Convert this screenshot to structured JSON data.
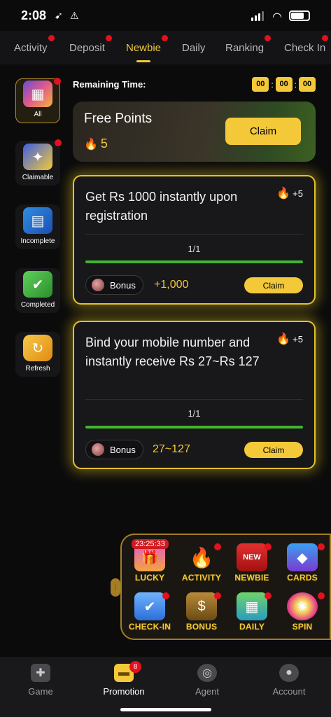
{
  "status_bar": {
    "time": "2:08"
  },
  "tabs": [
    {
      "label": "Activity",
      "dot": true
    },
    {
      "label": "Deposit",
      "dot": true
    },
    {
      "label": "Newbie",
      "dot": true,
      "active": true
    },
    {
      "label": "Daily",
      "dot": false
    },
    {
      "label": "Ranking",
      "dot": true
    },
    {
      "label": "Check In",
      "dot": true
    }
  ],
  "sidebar": {
    "items": [
      {
        "label": "All",
        "icon": "cube-icon",
        "active": true,
        "dot": true
      },
      {
        "label": "Claimable",
        "icon": "gift-stack-icon",
        "dot": true
      },
      {
        "label": "Incomplete",
        "icon": "cards-icon",
        "dot": false
      },
      {
        "label": "Completed",
        "icon": "calendar-check-icon",
        "dot": false
      },
      {
        "label": "Refresh",
        "icon": "refresh-icon",
        "dot": false
      }
    ]
  },
  "remaining": {
    "label": "Remaining Time:",
    "hh": "00",
    "mm": "00",
    "ss": "00"
  },
  "free_points": {
    "title": "Free Points",
    "points": "5",
    "claim_label": "Claim"
  },
  "tasks": [
    {
      "title": "Get Rs 1000  instantly upon registration",
      "points": "+5",
      "progress_text": "1/1",
      "progress": 1.0,
      "bonus_label": "Bonus",
      "amount": "+1,000",
      "claim_label": "Claim"
    },
    {
      "title": "Bind your mobile number and instantly receive Rs 27~Rs 127",
      "points": "+5",
      "progress_text": "1/1",
      "progress": 1.0,
      "bonus_label": "Bonus",
      "amount": "27~127",
      "claim_label": "Claim"
    }
  ],
  "games_panel": {
    "timer": "23:25:33",
    "items": [
      {
        "label": "LUCKY",
        "icon": "lucky-chest-icon"
      },
      {
        "label": "ACTIVITY",
        "icon": "fire-icon"
      },
      {
        "label": "NEWBIE",
        "icon": "new-gift-icon"
      },
      {
        "label": "CARDS",
        "icon": "diamond-card-icon"
      },
      {
        "label": "CHECK-IN",
        "icon": "calendar-icon"
      },
      {
        "label": "BONUS",
        "icon": "money-bag-icon"
      },
      {
        "label": "DAILY",
        "icon": "daily-calendar-icon"
      },
      {
        "label": "SPIN",
        "icon": "wheel-icon"
      }
    ]
  },
  "bottom_nav": {
    "items": [
      {
        "label": "Game",
        "icon": "gamepad-icon"
      },
      {
        "label": "Promotion",
        "icon": "promotion-gift-icon",
        "badge": "8",
        "active": true
      },
      {
        "label": "Agent",
        "icon": "coin-stack-icon"
      },
      {
        "label": "Account",
        "icon": "user-icon"
      }
    ]
  },
  "colors": {
    "accent": "#f3c93a",
    "badge_red": "#e3111f",
    "progress_green": "#44b431"
  }
}
